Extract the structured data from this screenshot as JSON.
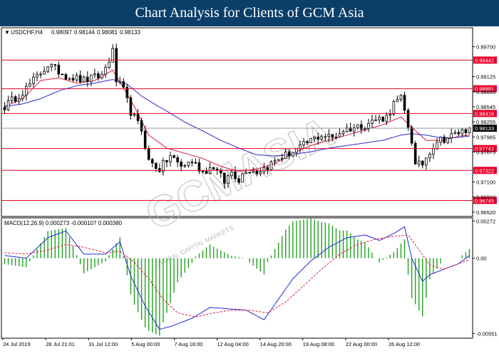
{
  "banner": {
    "title": "Chart Analysis for Clients of GCM Asia"
  },
  "watermark": {
    "text": "GCMASIA",
    "subtext": "GLOBAL CAPITAL MARKETS"
  },
  "colors": {
    "banner": "#0b3f6a",
    "candle": "#000000",
    "ma_fast": "#e0183c",
    "ma_slow": "#2a2ad8",
    "level_line": "#e8002a",
    "level_label_bg": "#e8002a",
    "current_label_bg": "#000000",
    "macd_line": "#1f2bd8",
    "signal_line": "#e0183c",
    "histogram": "#22a022"
  },
  "chart_data": [
    {
      "type": "candlestick",
      "title": "USDCHF,H4",
      "header_values": [
        "0.98097",
        "0.98144",
        "0.98081",
        "0.98133"
      ],
      "ylim": [
        0.9645,
        1.0005
      ],
      "y_tick_labels": [
        {
          "value": 0.997,
          "label": "0.99700"
        },
        {
          "value": 0.99125,
          "label": "0.99125"
        },
        {
          "value": 0.98835,
          "label": "0.98835"
        },
        {
          "value": 0.98545,
          "label": "0.98545"
        },
        {
          "value": 0.98255,
          "label": "0.98255"
        },
        {
          "value": 0.97965,
          "label": "0.97965"
        },
        {
          "value": 0.97675,
          "label": "0.97675"
        },
        {
          "value": 0.971,
          "label": "0.97100"
        },
        {
          "value": 0.9681,
          "label": "0.96810"
        },
        {
          "value": 0.9652,
          "label": "0.96520"
        }
      ],
      "levels": [
        {
          "value": 0.99442,
          "label": "0.99442"
        },
        {
          "value": 0.98891,
          "label": "0.98891"
        },
        {
          "value": 0.98416,
          "label": "0.98416"
        },
        {
          "value": 0.97741,
          "label": "0.97741"
        },
        {
          "value": 0.97322,
          "label": "0.97322"
        },
        {
          "value": 0.96745,
          "label": "0.96745"
        }
      ],
      "current_price": {
        "value": 0.98133,
        "label": "0.98133"
      },
      "x_labels": [
        "24 Jul 2019",
        "28 Jul 21:01",
        "31 Jul 12:00",
        "5 Aug 00:00",
        "7 Aug 16:00",
        "12 Aug 04:00",
        "14 Aug 20:00",
        "19 Aug 08:00",
        "22 Aug 00:00",
        "26 Aug 12:00"
      ],
      "path_points": [
        [
          0,
          0.9855
        ],
        [
          6,
          0.989
        ],
        [
          12,
          0.9935
        ],
        [
          17,
          0.9915
        ],
        [
          22,
          0.9905
        ],
        [
          27,
          0.9915
        ],
        [
          30,
          0.996
        ],
        [
          31,
          0.9905
        ],
        [
          33,
          0.9885
        ],
        [
          35,
          0.9845
        ],
        [
          38,
          0.981
        ],
        [
          40,
          0.975
        ],
        [
          43,
          0.9735
        ],
        [
          46,
          0.976
        ],
        [
          49,
          0.974
        ],
        [
          52,
          0.975
        ],
        [
          55,
          0.973
        ],
        [
          58,
          0.974
        ],
        [
          61,
          0.971
        ],
        [
          63,
          0.973
        ],
        [
          65,
          0.9715
        ],
        [
          67,
          0.9735
        ],
        [
          70,
          0.973
        ],
        [
          73,
          0.974
        ],
        [
          76,
          0.9755
        ],
        [
          79,
          0.9765
        ],
        [
          82,
          0.9775
        ],
        [
          85,
          0.979
        ],
        [
          88,
          0.98
        ],
        [
          91,
          0.9795
        ],
        [
          94,
          0.981
        ],
        [
          97,
          0.9815
        ],
        [
          100,
          0.982
        ],
        [
          103,
          0.983
        ],
        [
          106,
          0.9835
        ],
        [
          108,
          0.986
        ],
        [
          110,
          0.987
        ],
        [
          111,
          0.9845
        ],
        [
          113,
          0.979
        ],
        [
          114,
          0.974
        ],
        [
          116,
          0.9745
        ],
        [
          118,
          0.977
        ],
        [
          120,
          0.979
        ],
        [
          123,
          0.9795
        ],
        [
          126,
          0.9805
        ],
        [
          128,
          0.981
        ],
        [
          129,
          0.9813
        ]
      ],
      "moving_averages": [
        {
          "name": "fast",
          "points": [
            [
              0,
              0.9855
            ],
            [
              5,
              0.987
            ],
            [
              10,
              0.9905
            ],
            [
              15,
              0.991
            ],
            [
              20,
              0.99
            ],
            [
              25,
              0.9905
            ],
            [
              30,
              0.9925
            ],
            [
              33,
              0.989
            ],
            [
              36,
              0.9855
            ],
            [
              40,
              0.98
            ],
            [
              45,
              0.9775
            ],
            [
              50,
              0.9765
            ],
            [
              55,
              0.9755
            ],
            [
              60,
              0.974
            ],
            [
              65,
              0.973
            ],
            [
              70,
              0.9735
            ],
            [
              75,
              0.9745
            ],
            [
              80,
              0.9765
            ],
            [
              85,
              0.978
            ],
            [
              90,
              0.979
            ],
            [
              95,
              0.98
            ],
            [
              100,
              0.981
            ],
            [
              105,
              0.982
            ],
            [
              110,
              0.9835
            ],
            [
              113,
              0.9815
            ],
            [
              117,
              0.979
            ],
            [
              122,
              0.979
            ],
            [
              126,
              0.9798
            ],
            [
              129,
              0.98
            ]
          ]
        },
        {
          "name": "slow",
          "points": [
            [
              0,
              0.9855
            ],
            [
              5,
              0.986
            ],
            [
              10,
              0.987
            ],
            [
              15,
              0.9885
            ],
            [
              20,
              0.9895
            ],
            [
              25,
              0.99
            ],
            [
              30,
              0.9907
            ],
            [
              34,
              0.9898
            ],
            [
              38,
              0.9875
            ],
            [
              42,
              0.9858
            ],
            [
              46,
              0.9842
            ],
            [
              50,
              0.9825
            ],
            [
              55,
              0.9808
            ],
            [
              60,
              0.979
            ],
            [
              65,
              0.9775
            ],
            [
              70,
              0.9762
            ],
            [
              75,
              0.976
            ],
            [
              80,
              0.9763
            ],
            [
              85,
              0.9768
            ],
            [
              90,
              0.9775
            ],
            [
              95,
              0.978
            ],
            [
              100,
              0.9785
            ],
            [
              105,
              0.979
            ],
            [
              110,
              0.98
            ],
            [
              113,
              0.9803
            ],
            [
              117,
              0.98
            ],
            [
              121,
              0.9795
            ],
            [
              125,
              0.9795
            ],
            [
              129,
              0.9798
            ]
          ]
        }
      ]
    },
    {
      "type": "macd",
      "title": "MACD(12,26,9) 0.000273 -0.000107 0.000380",
      "ylim": [
        -0.0058,
        0.0029
      ],
      "y_tick_labels": [
        {
          "value": 0.00272,
          "label": "0.00272"
        },
        {
          "value": 0.0,
          "label": "0.00"
        },
        {
          "value": -0.00551,
          "label": "-0.00551"
        }
      ],
      "macd_points": [
        [
          0,
          0.0002
        ],
        [
          6,
          0.0
        ],
        [
          12,
          0.0015
        ],
        [
          17,
          0.002
        ],
        [
          22,
          0.0003
        ],
        [
          28,
          0.0003
        ],
        [
          32,
          0.0012
        ],
        [
          35,
          -0.0013
        ],
        [
          39,
          -0.0035
        ],
        [
          43,
          -0.0052
        ],
        [
          46,
          -0.005
        ],
        [
          52,
          -0.0044
        ],
        [
          57,
          -0.0036
        ],
        [
          62,
          -0.0037
        ],
        [
          67,
          -0.0038
        ],
        [
          72,
          -0.0045
        ],
        [
          76,
          -0.003
        ],
        [
          80,
          -0.0015
        ],
        [
          85,
          -0.0002
        ],
        [
          90,
          0.0008
        ],
        [
          95,
          0.0015
        ],
        [
          100,
          0.0017
        ],
        [
          104,
          0.0013
        ],
        [
          108,
          0.0018
        ],
        [
          111,
          0.0023
        ],
        [
          113,
          0.0
        ],
        [
          116,
          -0.0017
        ],
        [
          118,
          -0.0012
        ],
        [
          122,
          -0.0008
        ],
        [
          126,
          -0.0004
        ],
        [
          129,
          0.0002
        ]
      ],
      "signal_points": [
        [
          0,
          0.0004
        ],
        [
          6,
          0.0003
        ],
        [
          12,
          0.0006
        ],
        [
          17,
          0.001
        ],
        [
          22,
          0.0008
        ],
        [
          28,
          0.0004
        ],
        [
          32,
          0.0005
        ],
        [
          36,
          -0.0003
        ],
        [
          40,
          -0.0015
        ],
        [
          44,
          -0.003
        ],
        [
          48,
          -0.004
        ],
        [
          53,
          -0.0043
        ],
        [
          58,
          -0.004
        ],
        [
          63,
          -0.0038
        ],
        [
          68,
          -0.0038
        ],
        [
          73,
          -0.004
        ],
        [
          78,
          -0.0032
        ],
        [
          83,
          -0.002
        ],
        [
          88,
          -0.0008
        ],
        [
          93,
          0.0003
        ],
        [
          98,
          0.001
        ],
        [
          103,
          0.0014
        ],
        [
          108,
          0.0016
        ],
        [
          112,
          0.0017
        ],
        [
          115,
          0.0006
        ],
        [
          118,
          -0.0005
        ],
        [
          122,
          -0.0008
        ],
        [
          126,
          -0.0004
        ],
        [
          129,
          -0.0001
        ]
      ]
    }
  ]
}
